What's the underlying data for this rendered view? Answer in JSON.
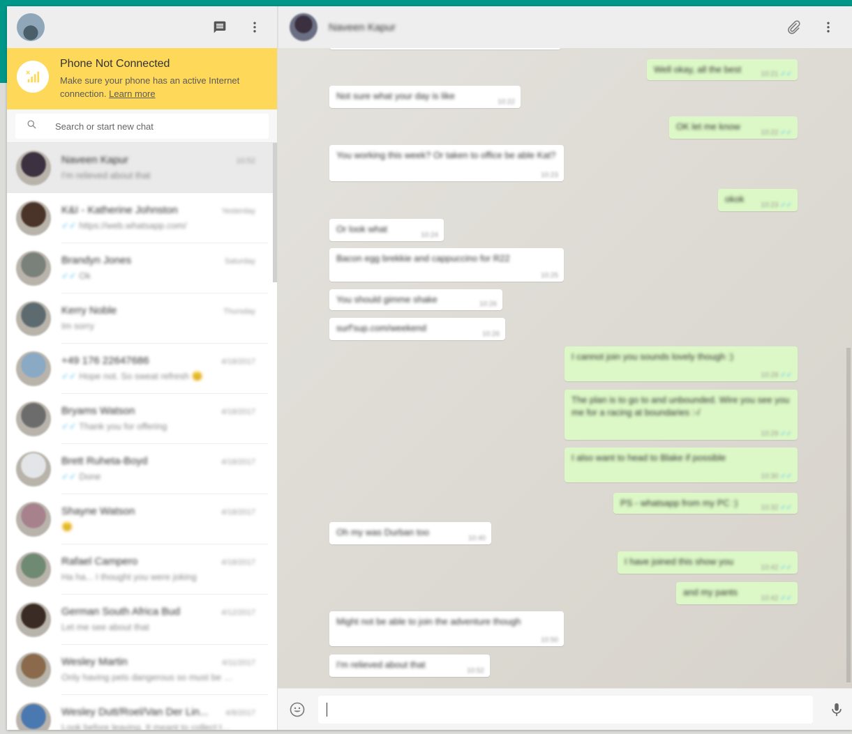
{
  "banner": {
    "title": "Phone Not Connected",
    "text": "Make sure your phone has an active Internet connection.",
    "link": "Learn more"
  },
  "search": {
    "placeholder": "Search or start new chat"
  },
  "colors": {
    "accent": "#009688",
    "banner": "#fed859",
    "outgoing": "#dcf8c6",
    "tick": "#4fc3f7"
  },
  "header": {
    "contact_name": "Naveen Kapur"
  },
  "chats": [
    {
      "name": "Naveen Kapur",
      "time": "10:52",
      "preview": "I'm relieved about that",
      "tick": false,
      "color": "#3b3140"
    },
    {
      "name": "K&I - Katherine Johnston",
      "time": "Yesterday",
      "preview": "https://web.whatsapp.com/",
      "tick": true,
      "color": "#4a3328"
    },
    {
      "name": "Brandyn Jones",
      "time": "Saturday",
      "preview": "Ok",
      "tick": true,
      "color": "#7a807a"
    },
    {
      "name": "Kerry Noble",
      "time": "Thursday",
      "preview": "Im sorry",
      "tick": false,
      "color": "#5d6a70"
    },
    {
      "name": "+49 176 22647686",
      "time": "4/18/2017",
      "preview": "Hope not. So sweat refresh 😊",
      "tick": true,
      "color": "#8aa9c4"
    },
    {
      "name": "Bryams Watson",
      "time": "4/18/2017",
      "preview": "Thank you for offering",
      "tick": true,
      "color": "#6c6c6c"
    },
    {
      "name": "Brett Ruheta-Boyd",
      "time": "4/18/2017",
      "preview": "Done",
      "tick": true,
      "color": "#e3e6e8"
    },
    {
      "name": "Shayne Watson",
      "time": "4/18/2017",
      "preview": "😊",
      "tick": false,
      "color": "#a7828c"
    },
    {
      "name": "Rafael Campero",
      "time": "4/18/2017",
      "preview": "Ha ha... I thought you were joking",
      "tick": false,
      "color": "#6f8a72"
    },
    {
      "name": "German South Africa Bud",
      "time": "4/12/2017",
      "preview": "Let me see about that",
      "tick": false,
      "color": "#3a2b24"
    },
    {
      "name": "Wesley Martin",
      "time": "4/11/2017",
      "preview": "Only having pets dangerous so must be able to...",
      "tick": false,
      "color": "#8a6a4a"
    },
    {
      "name": "Wesley Dutt/Roel/Van Der Lin...",
      "time": "4/8/2017",
      "preview": "Look before leaving. It meant to collect the other",
      "tick": false,
      "color": "#4a78b0"
    }
  ],
  "messages": [
    {
      "dir": "out",
      "text": "Well okay, all the best",
      "time": "10:21"
    },
    {
      "dir": "in",
      "text": "Not sure what your day is like",
      "time": "10:22"
    },
    {
      "dir": "out",
      "text": "OK let me know",
      "time": "10:22"
    },
    {
      "dir": "in",
      "text": "You working this week? Or taken to office be able Kat?",
      "time": "10:23"
    },
    {
      "dir": "out",
      "text": "okok",
      "time": "10:23"
    },
    {
      "dir": "in",
      "text": "Or look what",
      "time": "10:24"
    },
    {
      "dir": "in",
      "text": "Bacon egg brekkie and cappuccino for R22",
      "time": "10:25"
    },
    {
      "dir": "in",
      "text": "You should gimme shake",
      "time": "10:26"
    },
    {
      "dir": "in",
      "text": "surf'sup.com/weekend",
      "time": "10:26"
    },
    {
      "dir": "out",
      "text": "I cannot join you sounds lovely though :)",
      "time": "10:28"
    },
    {
      "dir": "out",
      "text": "The plan is to go to and unbounded. Wire you see you me for a racing at boundaries :-/",
      "time": "10:29"
    },
    {
      "dir": "out",
      "text": "I also want to head to Blake if possible",
      "time": "10:30"
    },
    {
      "dir": "out",
      "text": "PS - whatsapp from my PC :)",
      "time": "10:32"
    },
    {
      "dir": "in",
      "text": "Oh my was Durban too",
      "time": "10:40"
    },
    {
      "dir": "out",
      "text": "I have joined this show you",
      "time": "10:42"
    },
    {
      "dir": "out",
      "text": "and my pants",
      "time": "10:42"
    },
    {
      "dir": "in",
      "text": "Might not be able to join the adventure though",
      "time": "10:50"
    },
    {
      "dir": "in",
      "text": "I'm relieved about that",
      "time": "10:52"
    }
  ]
}
